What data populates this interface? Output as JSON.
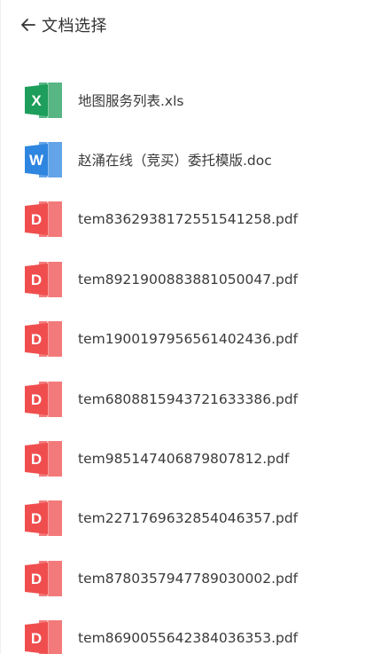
{
  "header": {
    "title": "文档选择",
    "back_icon": "arrow-left-icon"
  },
  "colors": {
    "excel": "#1e9e5b",
    "word": "#2f86e0",
    "pdf": "#f04e4e"
  },
  "files": [
    {
      "name": "地图服务列表.xls",
      "type": "excel",
      "letter": "X",
      "icon": "excel-icon"
    },
    {
      "name": "赵涌在线（竞买）委托模版.doc",
      "type": "word",
      "letter": "W",
      "icon": "word-icon"
    },
    {
      "name": "tem8362938172551541258.pdf",
      "type": "pdf",
      "letter": "D",
      "icon": "pdf-icon"
    },
    {
      "name": "tem8921900883881050047.pdf",
      "type": "pdf",
      "letter": "D",
      "icon": "pdf-icon"
    },
    {
      "name": "tem1900197956561402436.pdf",
      "type": "pdf",
      "letter": "D",
      "icon": "pdf-icon"
    },
    {
      "name": "tem6808815943721633386.pdf",
      "type": "pdf",
      "letter": "D",
      "icon": "pdf-icon"
    },
    {
      "name": "tem985147406879807812.pdf",
      "type": "pdf",
      "letter": "D",
      "icon": "pdf-icon"
    },
    {
      "name": "tem2271769632854046357.pdf",
      "type": "pdf",
      "letter": "D",
      "icon": "pdf-icon"
    },
    {
      "name": "tem8780357947789030002.pdf",
      "type": "pdf",
      "letter": "D",
      "icon": "pdf-icon"
    },
    {
      "name": "tem8690055642384036353.pdf",
      "type": "pdf",
      "letter": "D",
      "icon": "pdf-icon"
    }
  ]
}
